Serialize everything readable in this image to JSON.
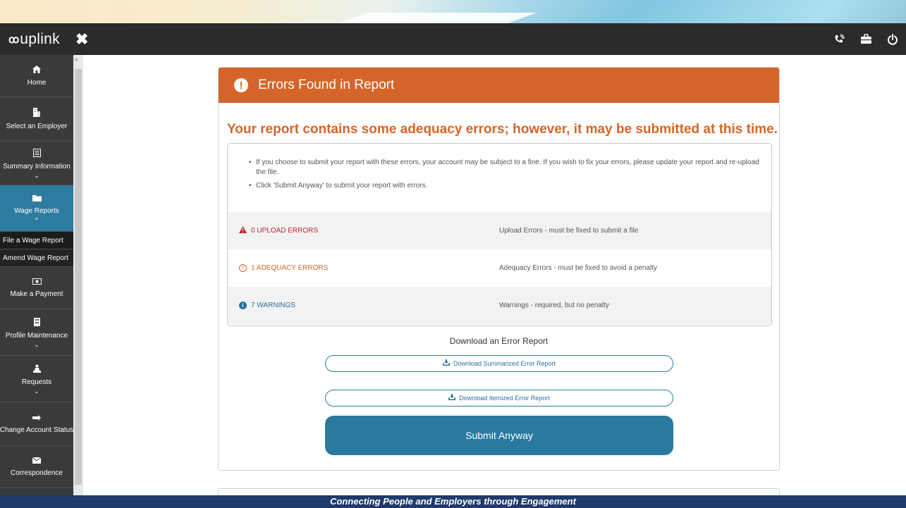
{
  "header": {
    "logo_mark": "ꝏ",
    "logo_text": "uplink",
    "close_glyph": "✖",
    "icons": [
      "phone-signal-icon",
      "briefcase-icon",
      "power-icon"
    ]
  },
  "sidebar": {
    "items": [
      {
        "icon": "home-icon",
        "glyph": "🏠",
        "label": "Home",
        "chevron": ""
      },
      {
        "icon": "building-icon",
        "glyph": "🏢",
        "label": "Select an Employer",
        "chevron": ""
      },
      {
        "icon": "summary-icon",
        "glyph": "▤",
        "label": "Summary Information",
        "chevron": "⌄"
      },
      {
        "icon": "folder-icon",
        "glyph": "📁",
        "label": "Wage Reports",
        "chevron": "^"
      },
      {
        "icon": "payment-icon",
        "glyph": "💵",
        "label": "Make a Payment",
        "chevron": ""
      },
      {
        "icon": "profile-icon",
        "glyph": "▦",
        "label": "Profile Maintenance",
        "chevron": "⌄"
      },
      {
        "icon": "requests-icon",
        "glyph": "♟",
        "label": "Requests",
        "chevron": "⌄"
      },
      {
        "icon": "status-icon",
        "glyph": "⇆",
        "label": "Change Account Status",
        "chevron": ""
      },
      {
        "icon": "envelope-icon",
        "glyph": "✉",
        "label": "Correspondence",
        "chevron": ""
      }
    ],
    "subitems": [
      "File a Wage Report",
      "Amend Wage Report"
    ]
  },
  "panel": {
    "title": "Errors Found in Report",
    "headline": "Your report contains some adequacy errors; however, it may be submitted at this time.",
    "bullets": [
      "If you choose to submit your report with these errors, your account may be subject to a fine. If you wish to fix your errors, please update your report and re-upload the file.",
      "Click 'Submit Anyway' to submit your report with errors."
    ],
    "errors": [
      {
        "label": "0 UPLOAD ERRORS",
        "desc": "Upload Errors - must be fixed to submit a file"
      },
      {
        "label": "1 ADEQUACY ERRORS",
        "desc": "Adequacy Errors - must be fixed to avoid a penalty"
      },
      {
        "label": "7 WARNINGS",
        "desc": "Warnings - required, but no penalty"
      }
    ],
    "download_title": "Download an Error Report",
    "download_summarized": "Download Summarized Error Report",
    "download_itemized": "Download Itemized Error Report",
    "submit_label": "Submit Anyway"
  },
  "footer": {
    "tagline": "Connecting People and Employers through Engagement"
  },
  "colors": {
    "accent_orange": "#d5652a",
    "accent_blue": "#2a7aa0",
    "error_red": "#c0262b",
    "footer_navy": "#1f3a6b"
  }
}
